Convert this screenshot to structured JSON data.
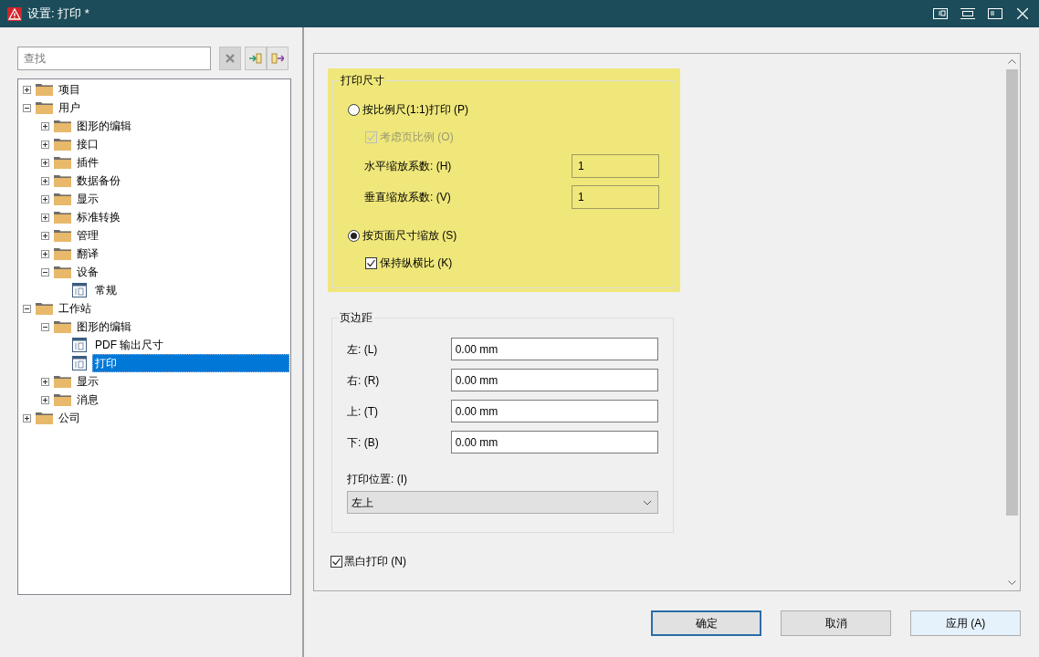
{
  "window": {
    "title": "设置: 打印 *"
  },
  "search": {
    "placeholder": "查找"
  },
  "tree": [
    {
      "label": "项目",
      "kind": "folder",
      "expanded": false,
      "selected": false
    },
    {
      "label": "用户",
      "kind": "folder",
      "expanded": true,
      "selected": false,
      "children": [
        {
          "label": "图形的编辑",
          "kind": "folder",
          "expanded": false,
          "selected": false
        },
        {
          "label": "接口",
          "kind": "folder",
          "expanded": false,
          "selected": false
        },
        {
          "label": "插件",
          "kind": "folder",
          "expanded": false,
          "selected": false
        },
        {
          "label": "数据备份",
          "kind": "folder",
          "expanded": false,
          "selected": false
        },
        {
          "label": "显示",
          "kind": "folder",
          "expanded": false,
          "selected": false
        },
        {
          "label": "标准转换",
          "kind": "folder",
          "expanded": false,
          "selected": false
        },
        {
          "label": "管理",
          "kind": "folder",
          "expanded": false,
          "selected": false
        },
        {
          "label": "翻译",
          "kind": "folder",
          "expanded": false,
          "selected": false
        },
        {
          "label": "设备",
          "kind": "folder",
          "expanded": true,
          "selected": false,
          "children": [
            {
              "label": "常规",
              "kind": "page",
              "selected": false
            }
          ]
        }
      ]
    },
    {
      "label": "工作站",
      "kind": "folder",
      "expanded": true,
      "selected": false,
      "children": [
        {
          "label": "图形的编辑",
          "kind": "folder",
          "expanded": true,
          "selected": false,
          "children": [
            {
              "label": "PDF 输出尺寸",
              "kind": "page",
              "selected": false
            },
            {
              "label": "打印",
              "kind": "page",
              "selected": true
            }
          ]
        },
        {
          "label": "显示",
          "kind": "folder",
          "expanded": false,
          "selected": false
        },
        {
          "label": "消息",
          "kind": "folder",
          "expanded": false,
          "selected": false
        }
      ]
    },
    {
      "label": "公司",
      "kind": "folder",
      "expanded": false,
      "selected": false
    }
  ],
  "print_size": {
    "title": "打印尺寸",
    "highlighted": true,
    "items": [
      {
        "kind": "radio",
        "label": "按比例尺(1:1)打印 (P)",
        "selected": false
      },
      {
        "kind": "checkbox",
        "label": "考虑页比例 (O)",
        "checked": true,
        "disabled": true
      },
      {
        "kind": "field",
        "label": "水平缩放系数: (H)",
        "value": "1"
      },
      {
        "kind": "field",
        "label": "垂直缩放系数: (V)",
        "value": "1"
      },
      {
        "kind": "radio",
        "label": "按页面尺寸缩放 (S)",
        "selected": true
      },
      {
        "kind": "checkbox",
        "label": "保持纵横比 (K)",
        "checked": true,
        "disabled": false
      }
    ]
  },
  "margins": {
    "title": "页边距",
    "fields": [
      {
        "label": "左: (L)",
        "value": "0.00 mm"
      },
      {
        "label": "右: (R)",
        "value": "0.00 mm"
      },
      {
        "label": "上: (T)",
        "value": "0.00 mm"
      },
      {
        "label": "下: (B)",
        "value": "0.00 mm"
      }
    ],
    "position": {
      "label": "打印位置: (I)",
      "value": "左上"
    }
  },
  "black_white": {
    "label": "黑白打印 (N)",
    "checked": true
  },
  "buttons": [
    {
      "label": "确定",
      "default": true,
      "hovered": false
    },
    {
      "label": "取消",
      "default": false,
      "hovered": false
    },
    {
      "label": "应用 (A)",
      "default": false,
      "hovered": true
    }
  ]
}
